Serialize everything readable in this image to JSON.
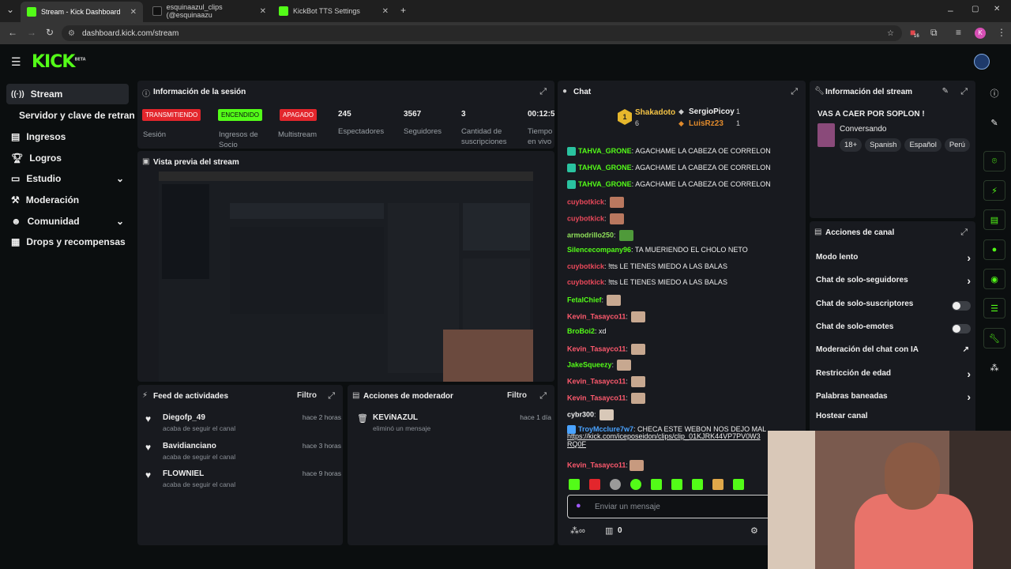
{
  "browser": {
    "tabs": [
      {
        "label": "Stream - Kick Dashboard",
        "color": "#53fc18"
      },
      {
        "label": "esquinaazul_clips (@esquinaazu",
        "color": "#111111"
      },
      {
        "label": "KickBot TTS Settings",
        "color": "#53fc18"
      }
    ],
    "url": "dashboard.kick.com/stream",
    "profile_initial": "K",
    "ext_badge": "16"
  },
  "header": {
    "logo": "KICK",
    "logo_sup": "BETA"
  },
  "sidebar": {
    "items": [
      {
        "label": "Stream",
        "icon": "broadcast-icon"
      },
      {
        "label": "Servidor y clave de retransm",
        "icon": ""
      },
      {
        "label": "Ingresos",
        "icon": "dollar-icon"
      },
      {
        "label": "Logros",
        "icon": "trophy-icon"
      },
      {
        "label": "Estudio",
        "icon": "monitor-icon"
      },
      {
        "label": "Moderación",
        "icon": "hammer-icon"
      },
      {
        "label": "Comunidad",
        "icon": "people-icon"
      },
      {
        "label": "Drops y recompensas",
        "icon": "gift-icon"
      }
    ]
  },
  "session": {
    "title": "Información de la sesión",
    "badges": [
      {
        "text": "TRANSMITIENDO",
        "label": "Sesión",
        "color": "#e3262c",
        "text_color": "#ffffff"
      },
      {
        "text": "ENCENDIDO",
        "label": "Ingresos de Socio",
        "color": "#53fc18",
        "text_color": "#0b0e0f"
      },
      {
        "text": "APAGADO",
        "label": "Multistream",
        "color": "#e3262c",
        "text_color": "#ffffff"
      }
    ],
    "stats": [
      {
        "value": "245",
        "label": "Espectadores"
      },
      {
        "value": "3567",
        "label": "Seguidores"
      },
      {
        "value": "3",
        "label": "Cantidad de suscripciones"
      },
      {
        "value": "00:12:5",
        "label": "Tiempo en vivo"
      }
    ]
  },
  "preview": {
    "title": "Vista previa del stream"
  },
  "feed": {
    "title": "Feed de actividades",
    "filter": "Filtro",
    "items": [
      {
        "name": "Diegofp_49",
        "sub": "acaba de seguir el canal",
        "time": "hace 2 horas"
      },
      {
        "name": "Bavidianciano",
        "sub": "acaba de seguir el canal",
        "time": "hace 3 horas"
      },
      {
        "name": "FLOWNIEL",
        "sub": "acaba de seguir el canal",
        "time": "hace 9 horas"
      }
    ]
  },
  "mod": {
    "title": "Acciones de moderador",
    "filter": "Filtro",
    "items": [
      {
        "name": "KEViNAZUL",
        "sub": "eliminó un mensaje",
        "time": "hace 1 día"
      }
    ]
  },
  "chat": {
    "title": "Chat",
    "top": [
      {
        "rank": "1",
        "name": "Shakadoto",
        "count": "6"
      },
      {
        "name": "SergioPicoy",
        "count": "1"
      },
      {
        "name": "LuisRz23",
        "count": "1"
      }
    ],
    "messages": [
      {
        "user": "TAHVA_GRONE",
        "sep": ":",
        "text": " AGACHAME LA CABEZA OE CORRELON",
        "color": "#53fc18"
      },
      {
        "user": "TAHVA_GRONE",
        "sep": ":",
        "text": " AGACHAME LA CABEZA OE CORRELON",
        "color": "#53fc18"
      },
      {
        "user": "TAHVA_GRONE",
        "sep": ":",
        "text": " AGACHAME LA CABEZA OE CORRELON",
        "color": "#53fc18"
      },
      {
        "user": "cuybotkick",
        "sep": ":",
        "text": "",
        "color": "#e8485a"
      },
      {
        "user": "cuybotkick",
        "sep": ":",
        "text": "",
        "color": "#e8485a"
      },
      {
        "user": "armodrillo250",
        "sep": ":",
        "text": "",
        "color": "#8fe05a"
      },
      {
        "user": "Silencecompany96",
        "sep": ":",
        "text": " TA MUERIENDO EL CHOLO NETO",
        "color": "#53fc18"
      },
      {
        "user": "cuybotkick",
        "sep": ":",
        "text": " !tts LE TIENES MIEDO A LAS BALAS",
        "color": "#e8485a"
      },
      {
        "user": "cuybotkick",
        "sep": ":",
        "text": " !tts LE TIENES MIEDO A LAS BALAS",
        "color": "#e8485a"
      },
      {
        "user": "FetalChief",
        "sep": ":",
        "text": "",
        "color": "#53fc18"
      },
      {
        "user": "Kevin_Tasayco11",
        "sep": ":",
        "text": "",
        "color": "#ff5a6e"
      },
      {
        "user": "BroBoi2",
        "sep": ":",
        "text": " xd",
        "color": "#53fc18"
      },
      {
        "user": "Kevin_Tasayco11",
        "sep": ":",
        "text": "",
        "color": "#ff5a6e"
      },
      {
        "user": "JakeSqueezy",
        "sep": ":",
        "text": "",
        "color": "#53fc18"
      },
      {
        "user": "Kevin_Tasayco11",
        "sep": ":",
        "text": "",
        "color": "#ff5a6e"
      },
      {
        "user": "Kevin_Tasayco11",
        "sep": ":",
        "text": "",
        "color": "#ff5a6e"
      },
      {
        "user": "cybr300",
        "sep": ":",
        "text": "",
        "color": "#eeeeee"
      },
      {
        "user": "TroyMcclure7w7",
        "sep": ":",
        "text": " CHECA ESTE WEBON NOS DEJO MAL",
        "color": "#4aa3ff"
      }
    ],
    "link": "https://kick.com/iceposeidon/clips/clip_01KJRK44VP7PV0W3",
    "link2": "RQ0F",
    "last": {
      "user": "Kevin_Tasayco11",
      "sep": ":",
      "color": "#ff5a6e"
    },
    "input_placeholder": "Enviar un mensaje",
    "footer_count": "0"
  },
  "stream_info": {
    "title": "Información del stream",
    "stream_title": "VAS A CAER POR SOPLON !",
    "category": "Conversando",
    "tags": [
      "18+",
      "Spanish",
      "Español",
      "Perú"
    ]
  },
  "channel": {
    "title": "Acciones de canal",
    "actions": [
      {
        "label": "Modo lento",
        "control": "chevron"
      },
      {
        "label": "Chat de solo-seguidores",
        "control": "chevron"
      },
      {
        "label": "Chat de solo-suscriptores",
        "control": "toggle"
      },
      {
        "label": "Chat de solo-emotes",
        "control": "toggle"
      },
      {
        "label": "Moderación del chat con IA",
        "control": "external"
      },
      {
        "label": "Restricción de edad",
        "control": "chevron"
      },
      {
        "label": "Palabras baneadas",
        "control": "chevron"
      },
      {
        "label": "Hostear canal",
        "control": "none"
      }
    ]
  }
}
